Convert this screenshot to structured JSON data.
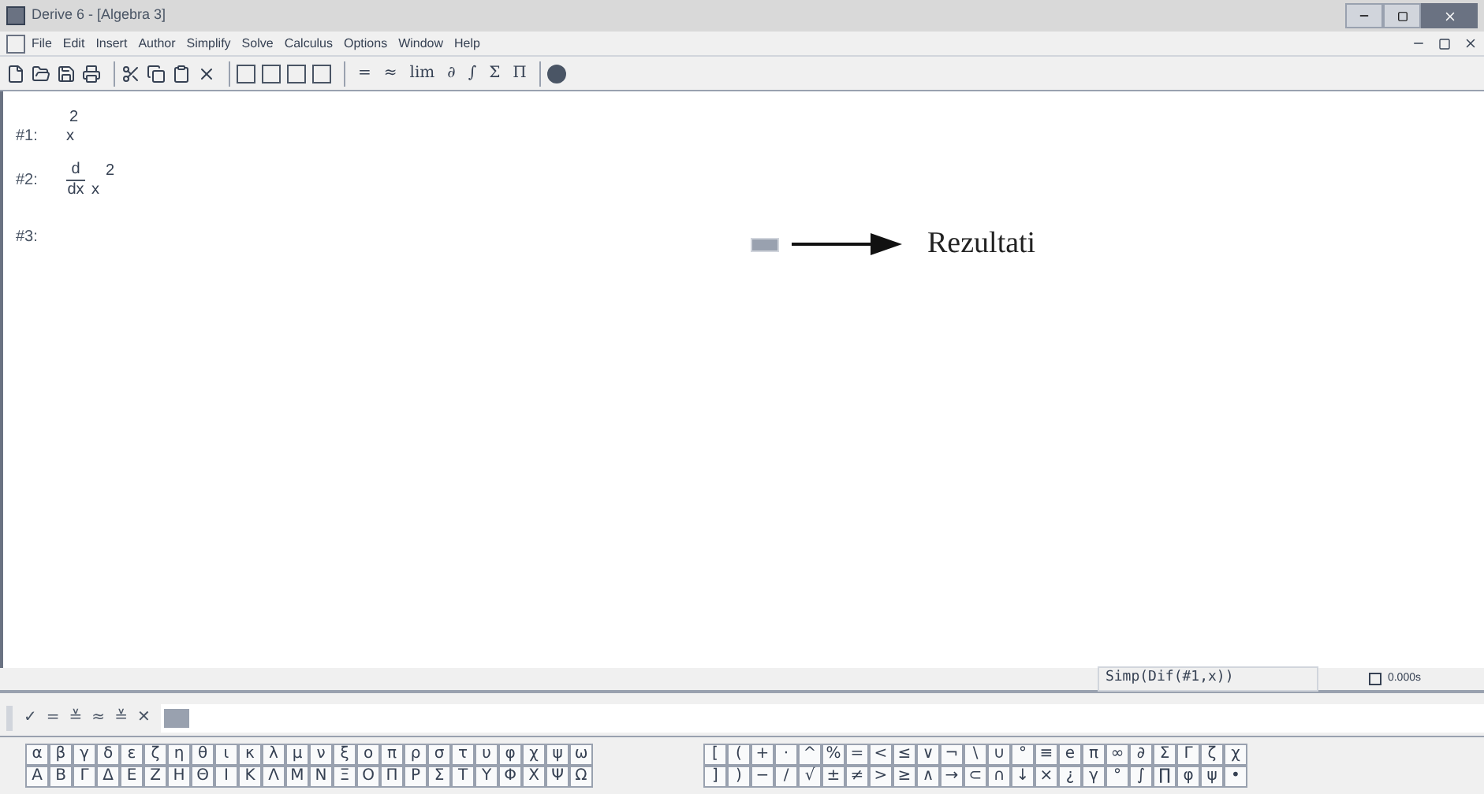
{
  "window": {
    "title": "Derive 6 - [Algebra 3]"
  },
  "menu": [
    "File",
    "Edit",
    "Insert",
    "Author",
    "Simplify",
    "Solve",
    "Calculus",
    "Options",
    "Window",
    "Help"
  ],
  "toolbar_glyphs": [
    "=",
    "≈",
    "lim",
    "∂",
    "∫",
    "Σ",
    "Π"
  ],
  "expressions": [
    {
      "label": "#1:",
      "kind": "power",
      "base": "x",
      "exponent": "2"
    },
    {
      "label": "#2:",
      "kind": "derivative",
      "numerator": "d",
      "denominator": "dx",
      "base": "x",
      "exponent": "2"
    },
    {
      "label": "#3:",
      "kind": "pending"
    }
  ],
  "annotation": {
    "text": "Rezultati"
  },
  "status_bar": {
    "command": "Simp(Dif(#1,x))",
    "time": "0.000s"
  },
  "entry_buttons": [
    "✓",
    "=",
    "≚",
    "≈",
    "≚",
    "✕"
  ],
  "greek_lower": [
    "α",
    "β",
    "γ",
    "δ",
    "ε",
    "ζ",
    "η",
    "θ",
    "ι",
    "κ",
    "λ",
    "μ",
    "ν",
    "ξ",
    "ο",
    "π",
    "ρ",
    "σ",
    "τ",
    "υ",
    "φ",
    "χ",
    "ψ",
    "ω"
  ],
  "greek_upper": [
    "Α",
    "Β",
    "Γ",
    "Δ",
    "Ε",
    "Ζ",
    "Η",
    "Θ",
    "Ι",
    "Κ",
    "Λ",
    "Μ",
    "Ν",
    "Ξ",
    "Ο",
    "Π",
    "Ρ",
    "Σ",
    "Τ",
    "Υ",
    "Φ",
    "Χ",
    "Ψ",
    "Ω"
  ],
  "math_row_1": [
    "[",
    "(",
    "+",
    "·",
    "^",
    "%",
    "=",
    "<",
    "≤",
    "∨",
    "¬",
    "\\",
    "∪",
    "°",
    "≡",
    "e",
    "π",
    "∞",
    "∂",
    "Σ",
    "Γ",
    "ζ",
    "χ"
  ],
  "math_row_2": [
    "]",
    ")",
    "−",
    "/",
    "√",
    "±",
    "≠",
    ">",
    "≥",
    "∧",
    "→",
    "⊂",
    "∩",
    "↓",
    "×",
    "¿",
    "γ",
    "°",
    "∫",
    "∏",
    "φ",
    "ψ",
    "•"
  ]
}
